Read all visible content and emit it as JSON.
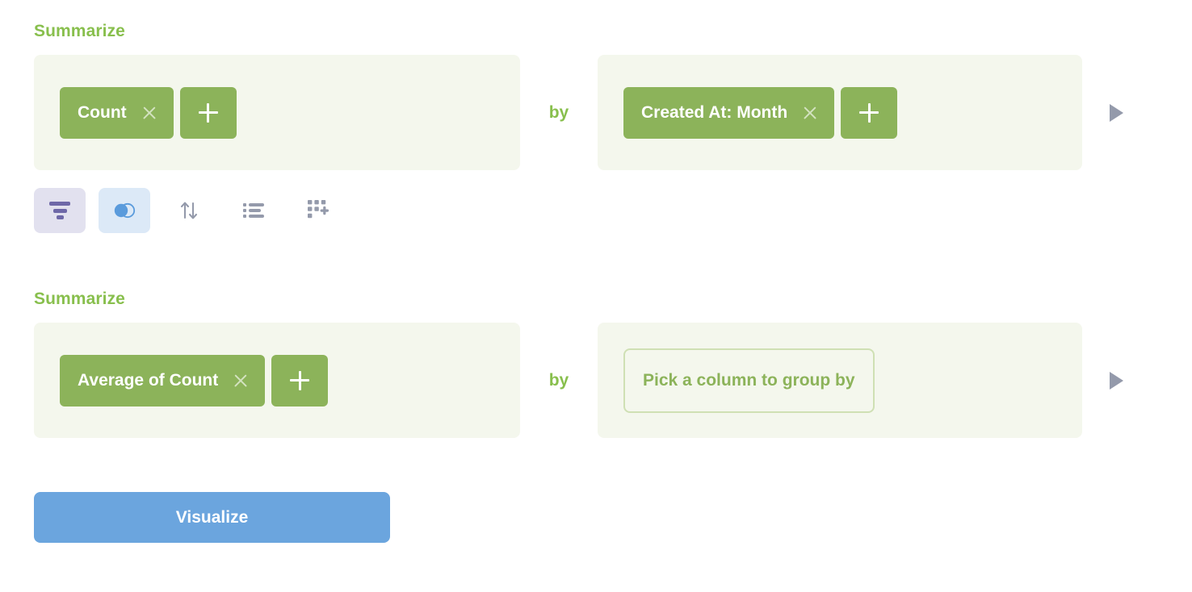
{
  "theme": {
    "accent_green": "#8cb35a",
    "pill_green": "#8cb35a",
    "clause_bg": "#f4f7ed",
    "placeholder_border": "#cfe0b4",
    "visualize_blue": "#6ba5de",
    "filter_purple": "#6e68a8",
    "filter_bg": "#e2e1ef",
    "join_blue": "#5a9bdc",
    "join_bg": "#dce9f7",
    "toolbar_icon_gray": "#949aab",
    "run_triangle_gray": "#949aab"
  },
  "steps": [
    {
      "title": "Summarize",
      "by_label": "by",
      "aggregations": [
        {
          "label": "Count",
          "remove_icon": "close-icon"
        }
      ],
      "aggregation_add_label": "+",
      "breakouts": [
        {
          "label": "Created At: Month",
          "remove_icon": "close-icon"
        }
      ],
      "breakout_add_label": "+",
      "breakout_placeholder": null,
      "run_icon": "play-triangle-icon"
    },
    {
      "title": "Summarize",
      "by_label": "by",
      "aggregations": [
        {
          "label": "Average of Count",
          "remove_icon": "close-icon"
        }
      ],
      "aggregation_add_label": "+",
      "breakouts": [],
      "breakout_add_label": "+",
      "breakout_placeholder": "Pick a column to group by",
      "run_icon": "play-triangle-icon"
    }
  ],
  "toolbar": {
    "buttons": [
      {
        "name": "filter",
        "icon": "filter-icon",
        "tooltip": "Filter",
        "active": true
      },
      {
        "name": "join",
        "icon": "join-venn-icon",
        "tooltip": "Join data",
        "active": true
      },
      {
        "name": "sort",
        "icon": "sort-arrows-icon",
        "tooltip": "Sort",
        "active": false
      },
      {
        "name": "row-limit",
        "icon": "list-icon",
        "tooltip": "Row limit",
        "active": false
      },
      {
        "name": "add-column",
        "icon": "grid-plus-icon",
        "tooltip": "Custom column",
        "active": false
      }
    ]
  },
  "footer": {
    "visualize_label": "Visualize"
  }
}
